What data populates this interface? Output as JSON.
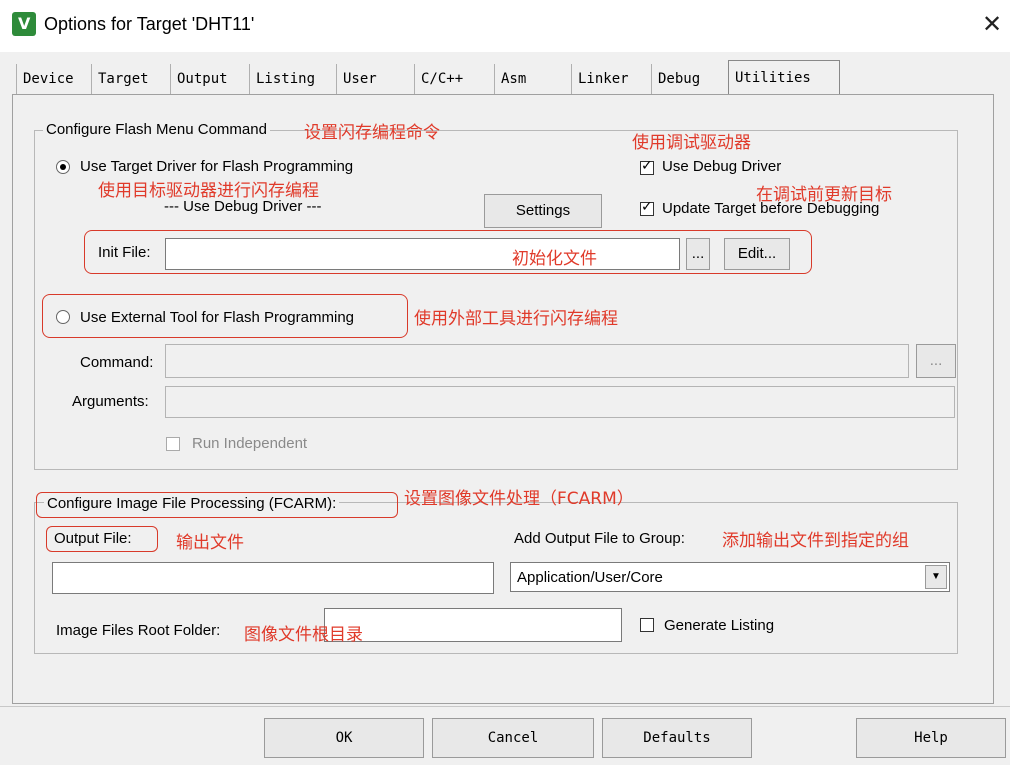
{
  "window": {
    "title": "Options for Target 'DHT11'"
  },
  "tabs": [
    "Device",
    "Target",
    "Output",
    "Listing",
    "User",
    "C/C++",
    "Asm",
    "Linker",
    "Debug",
    "Utilities"
  ],
  "flash": {
    "group_label": "Configure Flash Menu Command",
    "use_target_driver": "Use Target Driver for Flash Programming",
    "use_debug_driver_text": "--- Use Debug Driver ---",
    "settings_btn": "Settings",
    "use_debug_driver_check": "Use Debug Driver",
    "update_target_check": "Update Target before Debugging",
    "init_file_label": "Init File:",
    "init_file_value": "",
    "browse_btn": "...",
    "edit_btn": "Edit...",
    "use_external_tool": "Use External Tool for Flash Programming",
    "command_label": "Command:",
    "arguments_label": "Arguments:",
    "run_independent": "Run Independent"
  },
  "image": {
    "group_label": "Configure Image File Processing (FCARM):",
    "output_file_label": "Output File:",
    "output_file_value": "",
    "add_output_label": "Add Output File  to Group:",
    "group_select_value": "Application/User/Core",
    "root_folder_label": "Image Files Root Folder:",
    "generate_listing": "Generate Listing"
  },
  "buttons": {
    "ok": "OK",
    "cancel": "Cancel",
    "defaults": "Defaults",
    "help": "Help"
  },
  "annotations": {
    "flash_cmd": "设置闪存编程命令",
    "debug_driver": "使用调试驱动器",
    "target_driver": "使用目标驱动器进行闪存编程",
    "update_target": "在调试前更新目标",
    "init_file": "初始化文件",
    "external_tool": "使用外部工具进行闪存编程",
    "image_processing": "设置图像文件处理（FCARM）",
    "output_file": "输出文件",
    "add_to_group": "添加输出文件到指定的组",
    "root_folder": "图像文件根目录"
  }
}
